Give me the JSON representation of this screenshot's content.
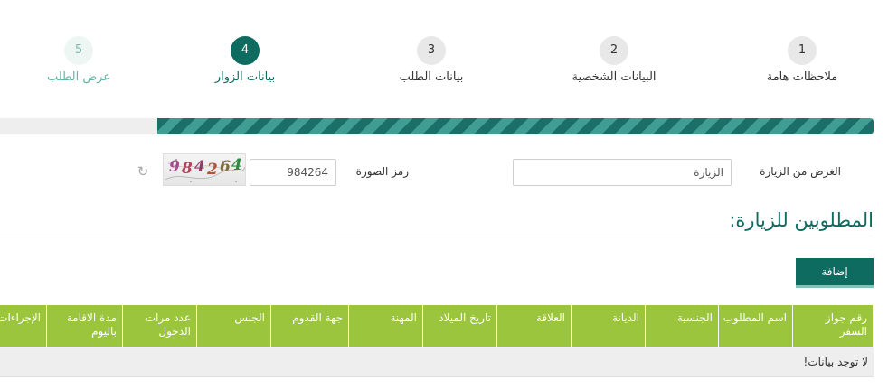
{
  "steps": [
    {
      "number": "1",
      "label": "ملاحظات هامة"
    },
    {
      "number": "2",
      "label": "البيانات الشخصية"
    },
    {
      "number": "3",
      "label": "بيانات الطلب"
    },
    {
      "number": "4",
      "label": "بيانات الزوار"
    },
    {
      "number": "5",
      "label": "عرض الطلب"
    }
  ],
  "active_step": 4,
  "progress_percent": 82,
  "form": {
    "purpose_label": "الغرض من الزيارة",
    "purpose_value": "الزيارة",
    "captcha_label": "رمز الصورة",
    "captcha_value": "984264",
    "captcha_image_text": "984264",
    "refresh_icon": "refresh-icon"
  },
  "section": {
    "title": "المطلوبين للزيارة:",
    "add_button": "إضافة"
  },
  "table": {
    "columns": [
      "رقم جواز السفر",
      "اسم المطلوب",
      "الجنسية",
      "الديانة",
      "العلاقة",
      "تاريخ الميلاد",
      "المهنة",
      "جهة القدوم",
      "الجنس",
      "عدد مرات الدخول",
      "مدة الاقامة باليوم",
      "الإجراءات"
    ],
    "empty_message": "لا توجد بيانات!"
  },
  "colors": {
    "primary": "#0e6b60",
    "table_header": "#9bc53d",
    "muted_step": "#5fb3a3"
  }
}
